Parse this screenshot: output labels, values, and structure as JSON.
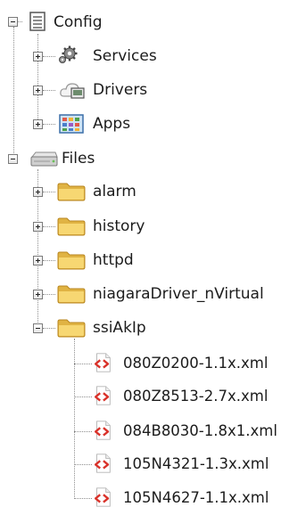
{
  "tree": {
    "config": {
      "label": "Config",
      "icon": "config-book-icon",
      "expanded": true,
      "children": [
        {
          "label": "Services",
          "icon": "services-gear-icon",
          "expanded": false
        },
        {
          "label": "Drivers",
          "icon": "drivers-cloud-icon",
          "expanded": false
        },
        {
          "label": "Apps",
          "icon": "apps-grid-icon",
          "expanded": false
        }
      ]
    },
    "files": {
      "label": "Files",
      "icon": "files-drive-icon",
      "expanded": true,
      "folders": [
        {
          "label": "alarm",
          "icon": "folder-icon",
          "expanded": false
        },
        {
          "label": "history",
          "icon": "folder-icon",
          "expanded": false
        },
        {
          "label": "httpd",
          "icon": "folder-icon",
          "expanded": false
        },
        {
          "label": "niagaraDriver_nVirtual",
          "icon": "folder-icon",
          "expanded": false
        },
        {
          "label": "ssiAkIp",
          "icon": "folder-icon",
          "expanded": true
        }
      ],
      "ssiAkIp_files": [
        {
          "label": "080Z0200-1.1x.xml",
          "icon": "xml-file-icon"
        },
        {
          "label": "080Z8513-2.7x.xml",
          "icon": "xml-file-icon"
        },
        {
          "label": "084B8030-1.8x1.xml",
          "icon": "xml-file-icon"
        },
        {
          "label": "105N4321-1.3x.xml",
          "icon": "xml-file-icon"
        },
        {
          "label": "105N4627-1.1x.xml",
          "icon": "xml-file-icon"
        }
      ]
    }
  },
  "colors": {
    "folder": "#f2c94c",
    "folder_dark": "#c9962a",
    "xml_red": "#d9332b",
    "connector": "#8f8f8f"
  }
}
